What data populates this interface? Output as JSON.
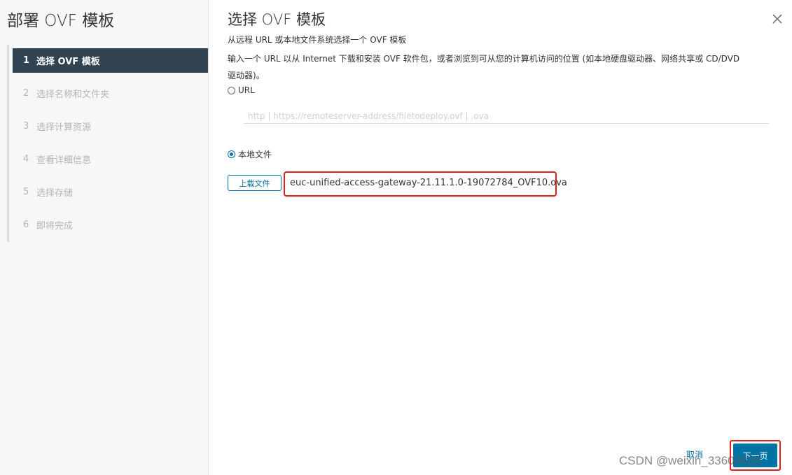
{
  "sidebar": {
    "title": "部署 OVF 模板",
    "steps": [
      {
        "num": "1",
        "label": "选择 OVF 模板",
        "active": true
      },
      {
        "num": "2",
        "label": "选择名称和文件夹",
        "active": false
      },
      {
        "num": "3",
        "label": "选择计算资源",
        "active": false
      },
      {
        "num": "4",
        "label": "查看详细信息",
        "active": false
      },
      {
        "num": "5",
        "label": "选择存储",
        "active": false
      },
      {
        "num": "6",
        "label": "即将完成",
        "active": false
      }
    ]
  },
  "main": {
    "title": "选择 OVF 模板",
    "description": "从远程 URL 或本地文件系统选择一个 OVF 模板",
    "instruction": "输入一个 URL 以从 Internet 下载和安装 OVF 软件包，或者浏览到可从您的计算机访问的位置 (如本地硬盘驱动器、网络共享或 CD/DVD 驱动器)。",
    "url_option": {
      "label": "URL",
      "checked": false
    },
    "url_input": {
      "placeholder": "http | https://remoteserver-address/filetodeploy.ovf | .ova",
      "value": ""
    },
    "local_option": {
      "label": "本地文件",
      "checked": true
    },
    "upload_button": "上载文件",
    "selected_file": "euc-unified-access-gateway-21.11.1.0-19072784_OVF10.ova"
  },
  "footer": {
    "cancel": "取消",
    "next": "下一页"
  },
  "watermark": "CSDN @weixin_33609839",
  "colors": {
    "accent": "#0072a3",
    "active_step": "#314351",
    "highlight": "#e02020"
  },
  "icons": {
    "close": "close-icon"
  }
}
